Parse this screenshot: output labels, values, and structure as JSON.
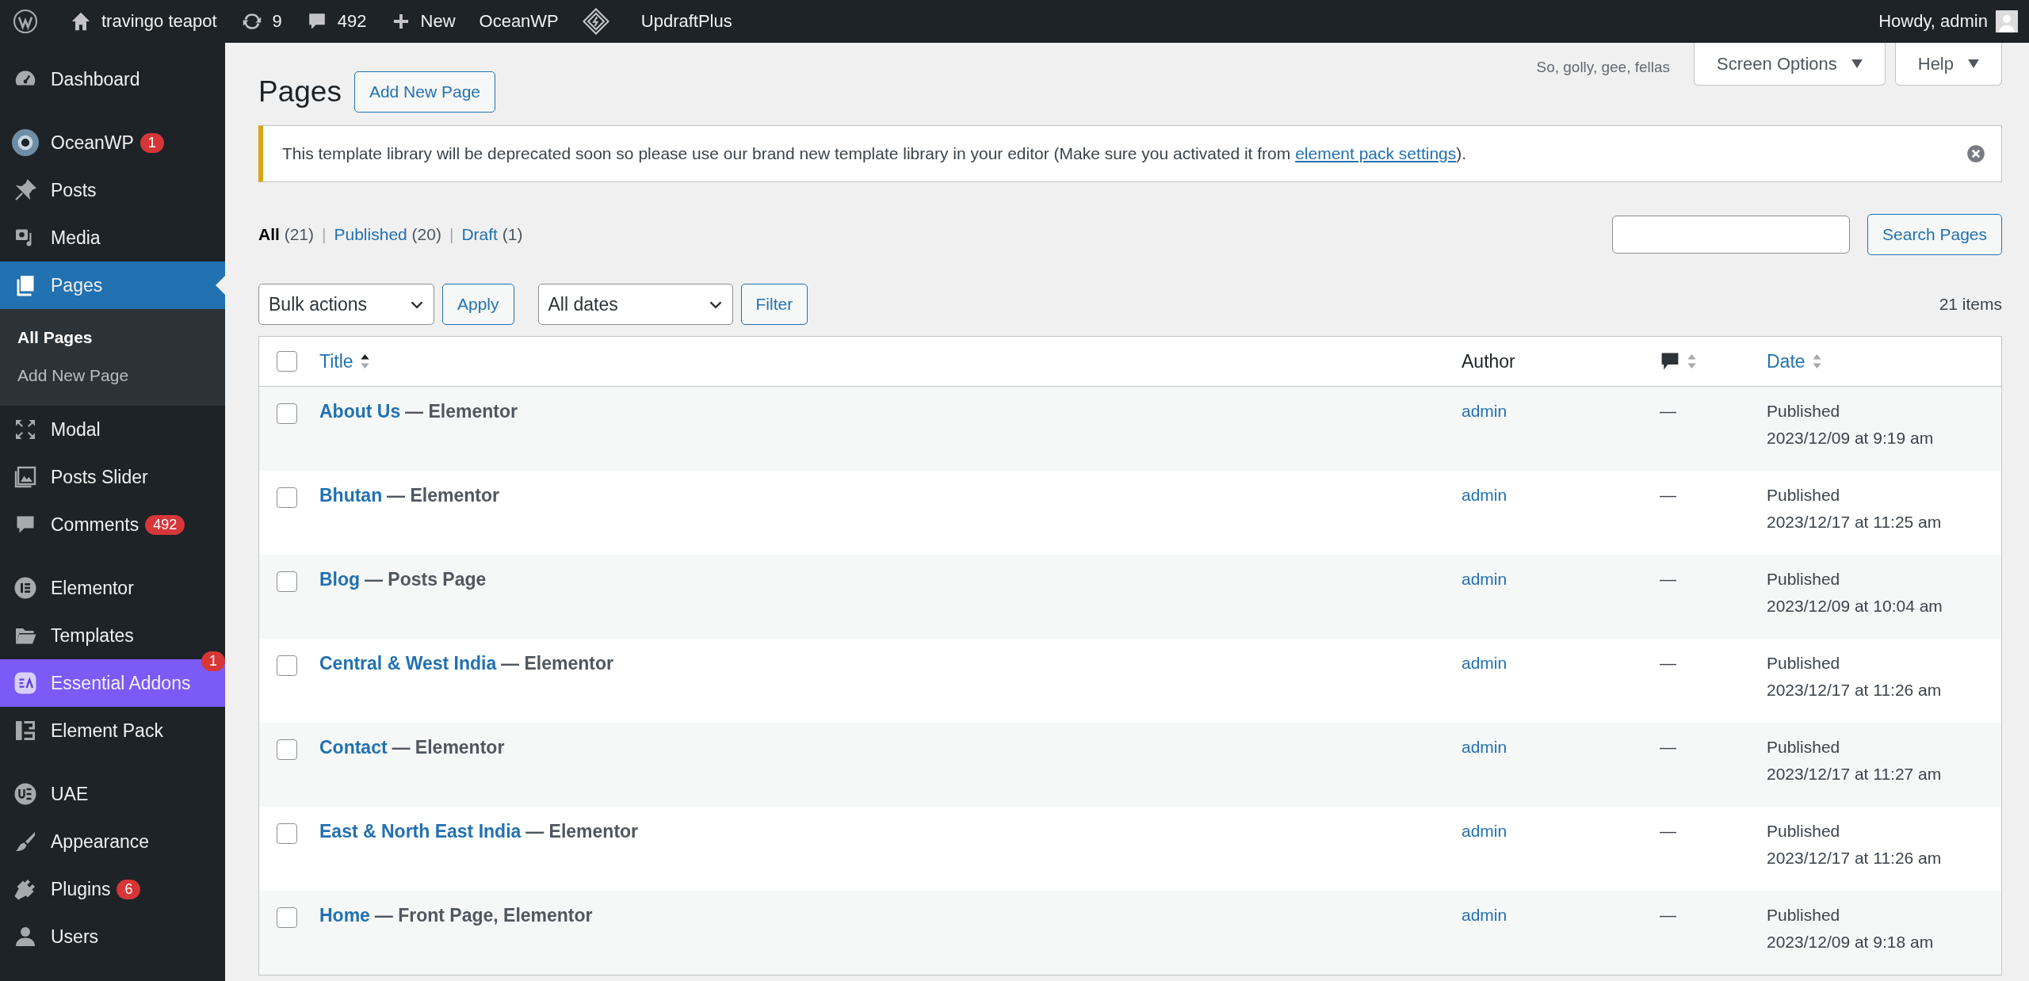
{
  "admin_bar": {
    "items": [
      {
        "kind": "logo"
      },
      {
        "kind": "home",
        "label": "travingo teapot"
      },
      {
        "kind": "updates",
        "label": "9"
      },
      {
        "kind": "comments",
        "label": "492"
      },
      {
        "kind": "new",
        "label": "New"
      },
      {
        "kind": "text",
        "label": "OceanWP"
      },
      {
        "kind": "diamond"
      },
      {
        "kind": "text",
        "label": "UpdraftPlus"
      }
    ],
    "greeting": "Howdy, admin"
  },
  "sidebar": {
    "groups": [
      [
        {
          "label": "Dashboard",
          "selected": false
        }
      ],
      [
        {
          "label": "OceanWP",
          "badge": "1",
          "selected": false
        },
        {
          "label": "Posts",
          "selected": false
        },
        {
          "label": "Media",
          "selected": false
        },
        {
          "label": "Pages",
          "selected": true,
          "submenu": [
            {
              "label": "All Pages",
              "selected": true
            },
            {
              "label": "Add New Page",
              "selected": false
            }
          ]
        },
        {
          "label": "Modal",
          "selected": false
        },
        {
          "label": "Posts Slider",
          "selected": false
        },
        {
          "label": "Comments",
          "badge": "492",
          "selected": false
        }
      ],
      [
        {
          "label": "Elementor",
          "selected": false
        },
        {
          "label": "Templates",
          "selected": false
        },
        {
          "label": "Essential Addons",
          "badge": "1",
          "color": "#7b5af5",
          "selected": false
        },
        {
          "label": "Element Pack",
          "selected": false
        }
      ],
      [
        {
          "label": "UAE",
          "selected": false
        },
        {
          "label": "Appearance",
          "selected": false
        },
        {
          "label": "Plugins",
          "badge": "6",
          "selected": false
        },
        {
          "label": "Users",
          "selected": false
        }
      ]
    ]
  },
  "hello_text": "So, golly, gee, fellas",
  "screen_tabs": [
    "Screen Options",
    "Help"
  ],
  "heading": "Pages",
  "add_new_button": "Add New Page",
  "notice": {
    "text_before": "This template library will be deprecated soon so please use our brand new template library in your editor (Make sure you activated it from ",
    "link": "element pack settings",
    "text_after": ")."
  },
  "filters": [
    {
      "label": "All",
      "count": "(21)",
      "selected": true,
      "separator": "|"
    },
    {
      "label": "Published",
      "count": "(20)",
      "selected": false,
      "separator": "|"
    },
    {
      "label": "Draft",
      "count": "(1)",
      "selected": false
    }
  ],
  "search_button": "Search Pages",
  "bulk_select": "Bulk actions",
  "apply_button": "Apply",
  "date_select": "All dates",
  "filter_button": "Filter",
  "item_count": "21 items",
  "table": {
    "select_all_checked": false,
    "columns": [
      {
        "kind": "title",
        "label": "Title",
        "sorted": true
      },
      {
        "kind": "author",
        "label": "Author"
      },
      {
        "kind": "comments",
        "sorted": false
      },
      {
        "kind": "date",
        "label": "Date",
        "sorted": false
      }
    ],
    "rows": [
      {
        "checked": false,
        "title": "About Us",
        "state": "— Elementor",
        "author": "admin",
        "comments": "—",
        "status": "Published",
        "date": "2023/12/09 at 9:19 am"
      },
      {
        "checked": false,
        "title": "Bhutan",
        "state": "— Elementor",
        "author": "admin",
        "comments": "—",
        "status": "Published",
        "date": "2023/12/17 at 11:25 am"
      },
      {
        "checked": false,
        "title": "Blog",
        "state": "— Posts Page",
        "author": "admin",
        "comments": "—",
        "status": "Published",
        "date": "2023/12/09 at 10:04 am"
      },
      {
        "checked": false,
        "title": "Central & West India",
        "state": "— Elementor",
        "author": "admin",
        "comments": "—",
        "status": "Published",
        "date": "2023/12/17 at 11:26 am"
      },
      {
        "checked": false,
        "title": "Contact",
        "state": "— Elementor",
        "author": "admin",
        "comments": "—",
        "status": "Published",
        "date": "2023/12/17 at 11:27 am"
      },
      {
        "checked": false,
        "title": "East & North East India",
        "state": "— Elementor",
        "author": "admin",
        "comments": "—",
        "status": "Published",
        "date": "2023/12/17 at 11:26 am"
      },
      {
        "checked": false,
        "title": "Home",
        "state": "— Front Page, Elementor",
        "author": "admin",
        "comments": "—",
        "status": "Published",
        "date": "2023/12/09 at 9:18 am"
      }
    ]
  }
}
